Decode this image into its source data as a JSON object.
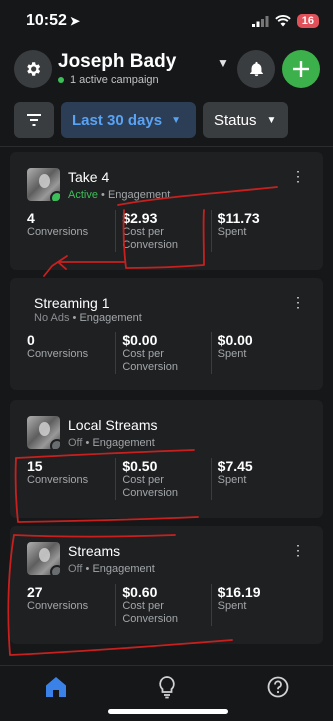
{
  "status_bar": {
    "time": "10:52",
    "battery": "16"
  },
  "header": {
    "account_name": "Joseph Bady",
    "campaign_count": "1 active campaign"
  },
  "filters": {
    "date_range": "Last 30 days",
    "status": "Status"
  },
  "campaigns": [
    {
      "name": "Take 4",
      "status": "Active",
      "status_color": "#3cbf58",
      "objective": "Engagement",
      "has_thumbnail": true,
      "metrics": [
        {
          "value": "4",
          "label": "Conversions"
        },
        {
          "value": "$2.93",
          "label": "Cost per Conversion"
        },
        {
          "value": "$11.73",
          "label": "Spent"
        }
      ]
    },
    {
      "name": "Streaming 1",
      "status": "No Ads",
      "status_color": "#8b8e91",
      "objective": "Engagement",
      "has_thumbnail": false,
      "metrics": [
        {
          "value": "0",
          "label": "Conversions"
        },
        {
          "value": "$0.00",
          "label": "Cost per Conversion"
        },
        {
          "value": "$0.00",
          "label": "Spent"
        }
      ]
    },
    {
      "name": "Local Streams",
      "status": "Off",
      "status_color": "#8b8e91",
      "objective": "Engagement",
      "has_thumbnail": true,
      "metrics": [
        {
          "value": "15",
          "label": "Conversions"
        },
        {
          "value": "$0.50",
          "label": "Cost per Conversion"
        },
        {
          "value": "$7.45",
          "label": "Spent"
        }
      ]
    },
    {
      "name": "Streams",
      "status": "Off",
      "status_color": "#8b8e91",
      "objective": "Engagement",
      "has_thumbnail": true,
      "metrics": [
        {
          "value": "27",
          "label": "Conversions"
        },
        {
          "value": "$0.60",
          "label": "Cost per Conversion"
        },
        {
          "value": "$16.19",
          "label": "Spent"
        }
      ]
    }
  ],
  "separator": "•",
  "icons": {
    "tab_home": "home-icon",
    "tab_insights": "lightbulb-icon",
    "tab_help": "help-icon"
  },
  "colors": {
    "accent_blue": "#5aa2f4",
    "add_green": "#3cb04a",
    "annotation_red": "#c8201f"
  }
}
